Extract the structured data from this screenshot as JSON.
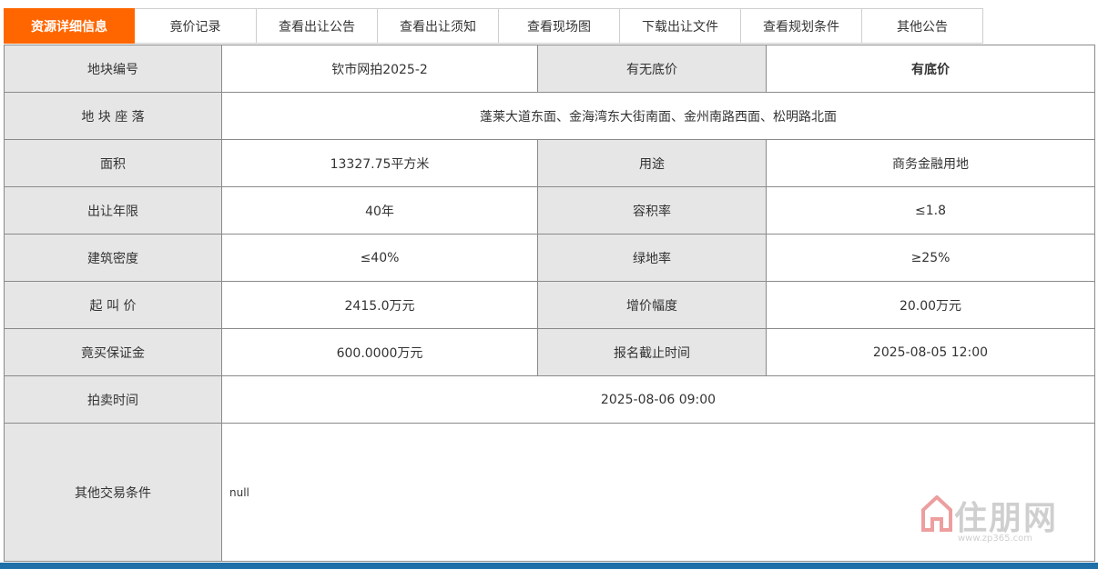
{
  "tabs": [
    {
      "label": "资源详细信息",
      "active": true
    },
    {
      "label": "竟价记录"
    },
    {
      "label": "查看出让公告"
    },
    {
      "label": "查看出让须知"
    },
    {
      "label": "查看现场图"
    },
    {
      "label": "下载出让文件"
    },
    {
      "label": "查看规划条件"
    },
    {
      "label": "其他公告"
    }
  ],
  "detail": {
    "row1": {
      "label_a": "地块编号",
      "value_a": "钦市网拍2025-2",
      "label_b": "有无底价",
      "value_b": "有底价"
    },
    "row2": {
      "label": "地 块 座 落",
      "value": "蓬莱大道东面、金海湾东大街南面、金州南路西面、松明路北面"
    },
    "row3": {
      "label_a": "面积",
      "value_a": "13327.75平方米",
      "label_b": "用途",
      "value_b": "商务金融用地"
    },
    "row4": {
      "label_a": "出让年限",
      "value_a": "40年",
      "label_b": "容积率",
      "value_b": "≤1.8"
    },
    "row5": {
      "label_a": "建筑密度",
      "value_a": "≤40%",
      "label_b": "绿地率",
      "value_b": "≥25%"
    },
    "row6": {
      "label_a": "起 叫 价",
      "value_a": "2415.0万元",
      "label_b": "增价幅度",
      "value_b": "20.00万元"
    },
    "row7": {
      "label_a": "竟买保证金",
      "value_a": "600.0000万元",
      "label_b": "报名截止时间",
      "value_b": "2025-08-05 12:00"
    },
    "row8": {
      "label": "拍卖时间",
      "value": "2025-08-06 09:00"
    },
    "row9": {
      "label": "其他交易条件",
      "value": "null"
    }
  },
  "watermark": {
    "brand": "住朋网",
    "site": "www.zp365.com"
  },
  "colors": {
    "accent": "#ff6600",
    "label_bg": "#e6e6e6",
    "highlight": "#cc0000",
    "footer_bar": "#1f6fa8"
  }
}
